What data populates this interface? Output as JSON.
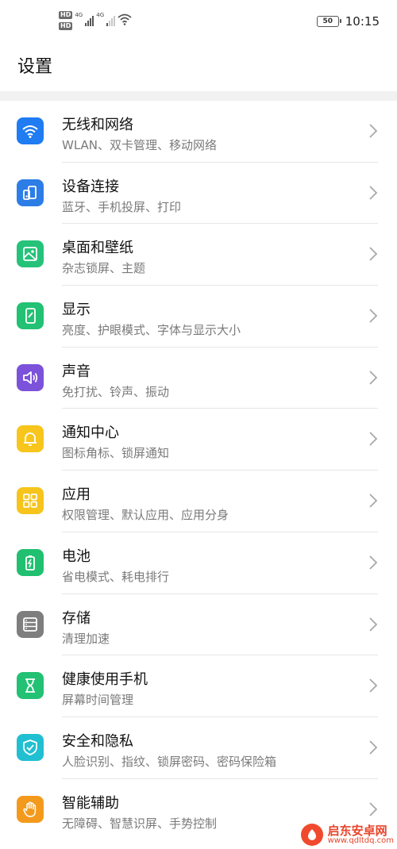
{
  "status_bar": {
    "hd1": "HD",
    "hd2": "HD",
    "net1": "4G",
    "net2": "4G",
    "battery": "50",
    "time": "10:15"
  },
  "page": {
    "title": "设置"
  },
  "settings": [
    {
      "title": "无线和网络",
      "subtitle": "WLAN、双卡管理、移动网络",
      "icon": "wifi-icon",
      "color": "#1f7cf2"
    },
    {
      "title": "设备连接",
      "subtitle": "蓝牙、手机投屏、打印",
      "icon": "device-connection-icon",
      "color": "#2d7de6"
    },
    {
      "title": "桌面和壁纸",
      "subtitle": "杂志锁屏、主题",
      "icon": "wallpaper-icon",
      "color": "#25c27a"
    },
    {
      "title": "显示",
      "subtitle": "亮度、护眼模式、字体与显示大小",
      "icon": "display-icon",
      "color": "#22c173"
    },
    {
      "title": "声音",
      "subtitle": "免打扰、铃声、振动",
      "icon": "sound-icon",
      "color": "#7b52d9"
    },
    {
      "title": "通知中心",
      "subtitle": "图标角标、锁屏通知",
      "icon": "bell-icon",
      "color": "#f7c51c"
    },
    {
      "title": "应用",
      "subtitle": "权限管理、默认应用、应用分身",
      "icon": "apps-icon",
      "color": "#f6c41b"
    },
    {
      "title": "电池",
      "subtitle": "省电模式、耗电排行",
      "icon": "battery-icon",
      "color": "#20c070"
    },
    {
      "title": "存储",
      "subtitle": "清理加速",
      "icon": "storage-icon",
      "color": "#7e7e7e"
    },
    {
      "title": "健康使用手机",
      "subtitle": "屏幕时间管理",
      "icon": "hourglass-icon",
      "color": "#22c173"
    },
    {
      "title": "安全和隐私",
      "subtitle": "人脸识别、指纹、锁屏密码、密码保险箱",
      "icon": "shield-icon",
      "color": "#21bfd2"
    },
    {
      "title": "智能辅助",
      "subtitle": "无障碍、智慧识屏、手势控制",
      "icon": "hand-icon",
      "color": "#f39a1d"
    }
  ],
  "watermark": {
    "name": "启东安卓网",
    "url": "www.qdltdq.com"
  }
}
